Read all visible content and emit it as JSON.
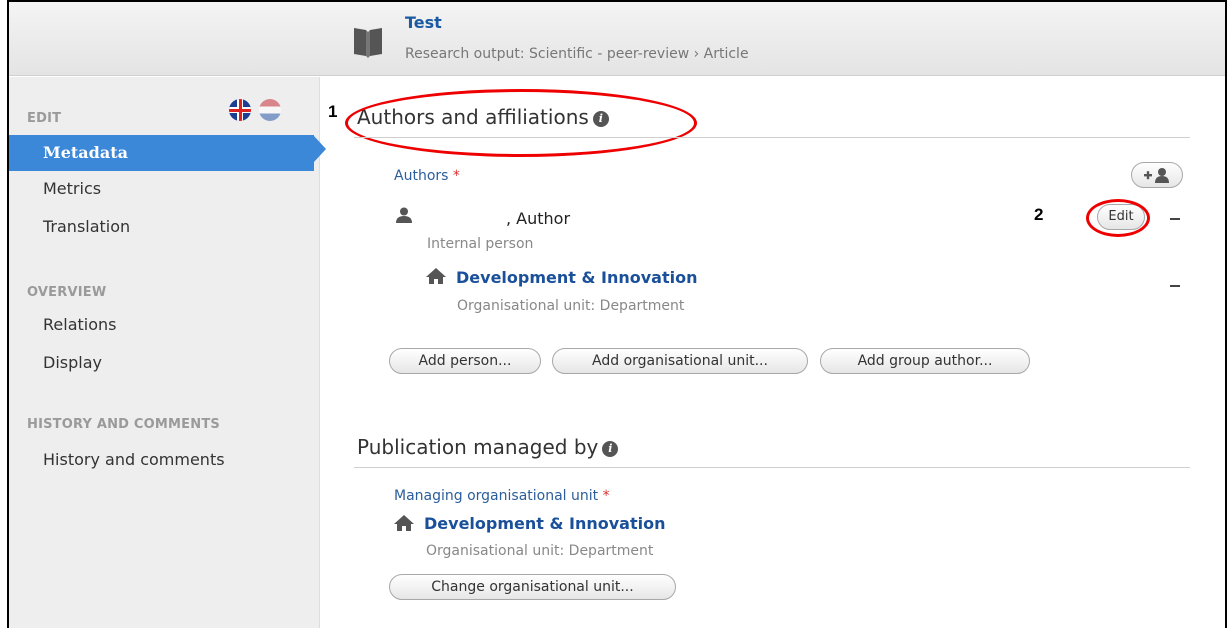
{
  "header": {
    "title": "Test",
    "subtitle": "Research output: Scientific - peer-review › Article"
  },
  "sidebar": {
    "edit_label": "EDIT",
    "edit_items": [
      {
        "label": "Metadata",
        "active": true
      },
      {
        "label": "Metrics"
      },
      {
        "label": "Translation"
      }
    ],
    "overview_label": "OVERVIEW",
    "overview_items": [
      {
        "label": "Relations"
      },
      {
        "label": "Display"
      }
    ],
    "history_label": "HISTORY AND COMMENTS",
    "history_items": [
      {
        "label": "History and comments"
      }
    ]
  },
  "annotations": {
    "marker1": "1",
    "marker2": "2",
    "highlight_color": "#e00000"
  },
  "authors_section": {
    "title": "Authors and affiliations",
    "authors_label": "Authors",
    "required_mark": "*",
    "author": {
      "name_suffix": ", Author",
      "type": "Internal person",
      "edit_label": "Edit"
    },
    "affiliation": {
      "name": "Development & Innovation",
      "type": "Organisational unit: Department"
    },
    "buttons": {
      "add_person": "Add person...",
      "add_org_unit": "Add organisational unit...",
      "add_group_author": "Add group author..."
    }
  },
  "managed_section": {
    "title": "Publication managed by",
    "managing_label": "Managing organisational unit",
    "required_mark": "*",
    "org": {
      "name": "Development & Innovation",
      "type": "Organisational unit: Department"
    },
    "change_button": "Change organisational unit..."
  },
  "colors": {
    "accent": "#3b87d8",
    "link": "#1a4f9a",
    "required": "#dd3333"
  }
}
